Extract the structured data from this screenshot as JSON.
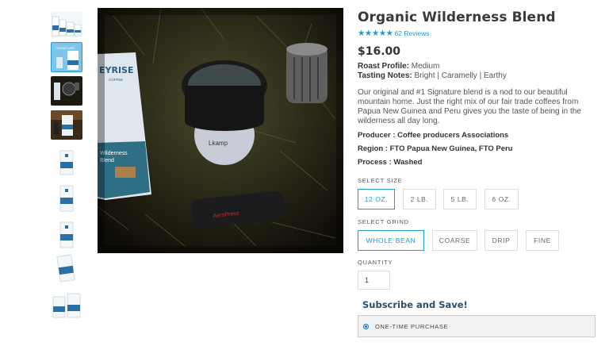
{
  "product": {
    "title": "Organic Wilderness Blend",
    "rating_stars": "★★★★★",
    "rating_value": 5,
    "reviews_label": "62 Reviews",
    "price": "$16.00",
    "roast_label": "Roast Profile:",
    "roast_value": " Medium",
    "tasting_label": "Tasting Notes:",
    "tasting_value": " Bright | Caramelly | Earthy",
    "description": "Our original and #1 Signature blend is a nod to our beautiful mountain home. Just the right mix of our fair trade coffees from Papua New Guinea and Peru gives you the taste of being in the wilderness all day long.",
    "producer": "Producer : Coffee producers Associations",
    "region": "Region : FTO Papua New Guinea, FTO Peru",
    "process": "Process : Washed"
  },
  "main_image": {
    "bag_brand_text": "EYRISE",
    "bag_sub_text": "COFFEE",
    "bag_label_line1": "Wilderness",
    "bag_label_line2": "Blend",
    "scale_brand": "Lkamp",
    "grinder_brand": "AeroPress"
  },
  "thumbnail_text": {
    "bag_label": "SIGNATURE"
  },
  "size_selector": {
    "label": "SELECT SIZE",
    "options": [
      "12 OZ.",
      "2 LB.",
      "5 LB.",
      "6 OZ."
    ],
    "selected": "12 OZ."
  },
  "grind_selector": {
    "label": "SELECT GRIND",
    "options": [
      "WHOLE BEAN",
      "COARSE",
      "DRIP",
      "FINE"
    ],
    "selected": "WHOLE BEAN"
  },
  "quantity": {
    "label": "QUANTITY",
    "value": "1"
  },
  "subscription": {
    "heading": "Subscribe and Save!",
    "one_time_label": "ONE-TIME PURCHASE"
  },
  "colors": {
    "accent": "#1f9bcf",
    "subscribe_heading": "#2a4f6a",
    "radio": "#1f6fb5"
  }
}
